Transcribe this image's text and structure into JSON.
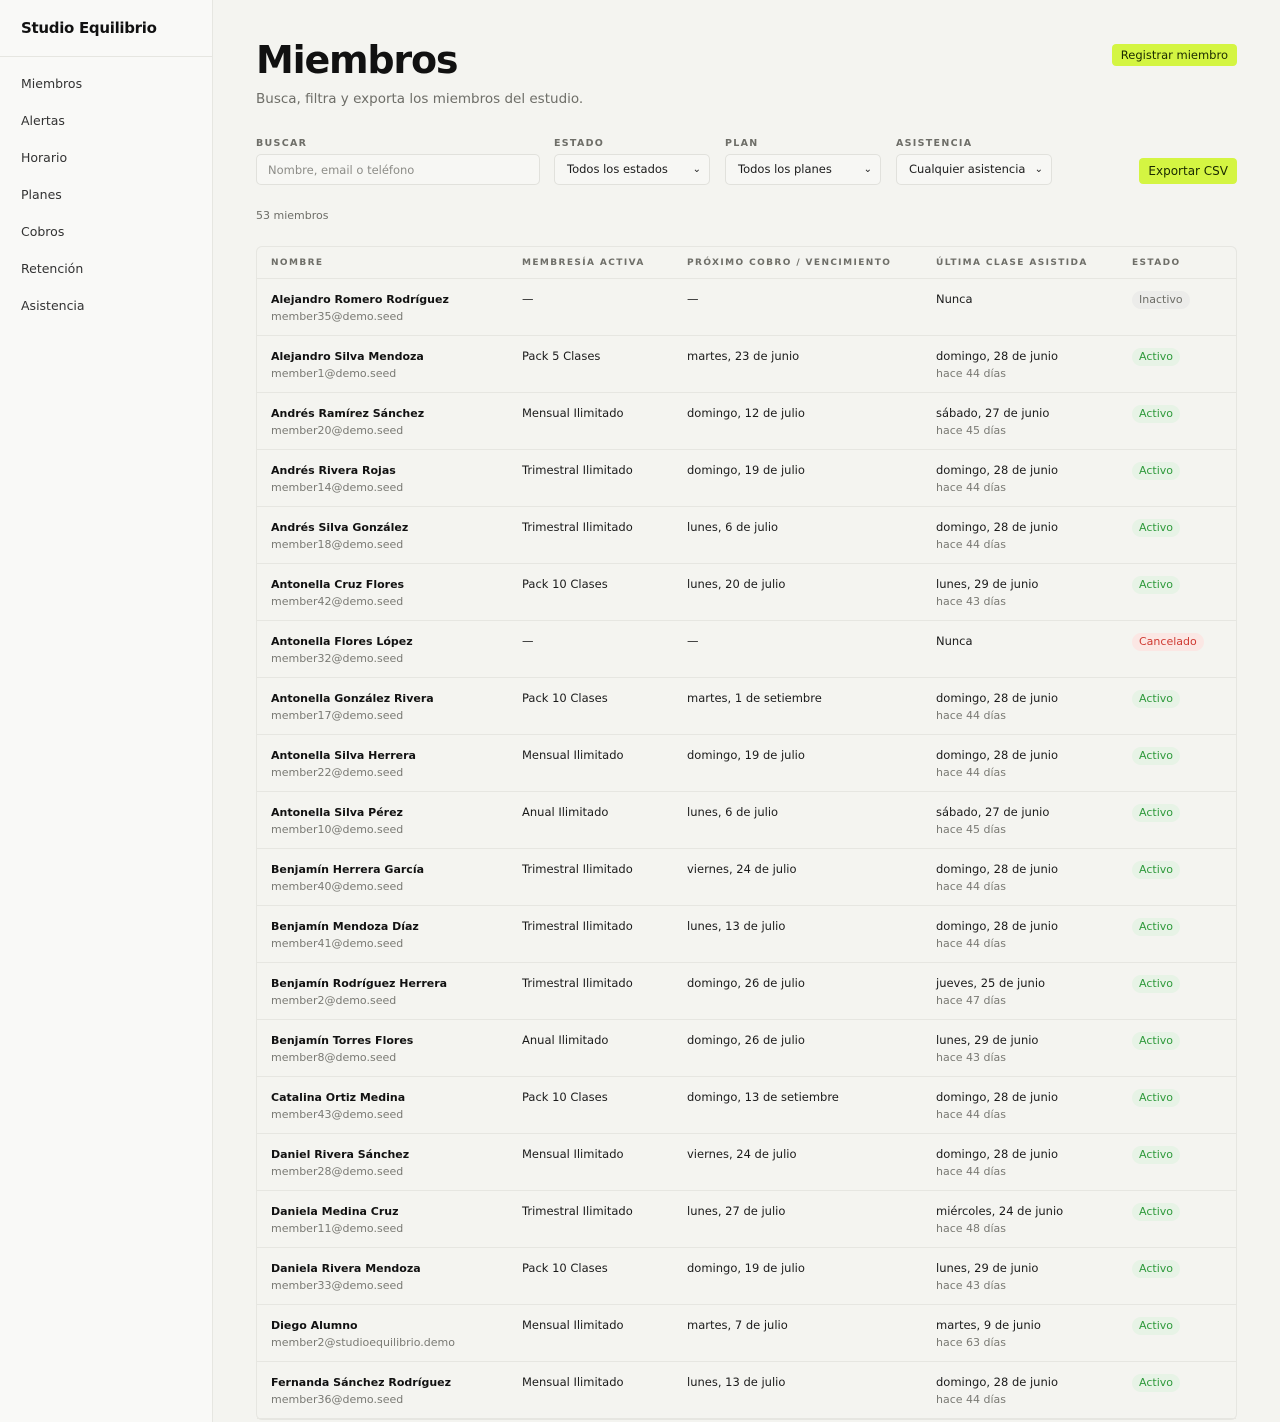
{
  "app": {
    "name": "Studio Equilibrio"
  },
  "sidebar": {
    "items": [
      {
        "label": "Miembros"
      },
      {
        "label": "Alertas"
      },
      {
        "label": "Horario"
      },
      {
        "label": "Planes"
      },
      {
        "label": "Cobros"
      },
      {
        "label": "Retención"
      },
      {
        "label": "Asistencia"
      }
    ]
  },
  "header": {
    "title": "Miembros",
    "subtitle": "Busca, filtra y exporta los miembros del estudio.",
    "register_label": "Registrar miembro"
  },
  "filters": {
    "search_label": "BUSCAR",
    "search_placeholder": "Nombre, email o teléfono",
    "status_label": "ESTADO",
    "status_value": "Todos los estados",
    "plan_label": "PLAN",
    "plan_value": "Todos los planes",
    "attendance_label": "ASISTENCIA",
    "attendance_value": "Cualquier asistencia",
    "export_label": "Exportar CSV"
  },
  "count_text": "53 miembros",
  "table": {
    "headers": {
      "name": "NOMBRE",
      "plan": "MEMBRESÍA ACTIVA",
      "next": "PRÓXIMO COBRO / VENCIMIENTO",
      "last": "ÚLTIMA CLASE ASISTIDA",
      "status": "ESTADO"
    },
    "rows": [
      {
        "name": "Alejandro Romero Rodríguez",
        "email": "member35@demo.seed",
        "plan": "—",
        "next": "—",
        "last": "Nunca",
        "last_ago": "",
        "status": "Inactivo",
        "kind": "inactive"
      },
      {
        "name": "Alejandro Silva Mendoza",
        "email": "member1@demo.seed",
        "plan": "Pack 5 Clases",
        "next": "martes, 23 de junio",
        "last": "domingo, 28 de junio",
        "last_ago": "hace 44 días",
        "status": "Activo",
        "kind": "active"
      },
      {
        "name": "Andrés Ramírez Sánchez",
        "email": "member20@demo.seed",
        "plan": "Mensual Ilimitado",
        "next": "domingo, 12 de julio",
        "last": "sábado, 27 de junio",
        "last_ago": "hace 45 días",
        "status": "Activo",
        "kind": "active"
      },
      {
        "name": "Andrés Rivera Rojas",
        "email": "member14@demo.seed",
        "plan": "Trimestral Ilimitado",
        "next": "domingo, 19 de julio",
        "last": "domingo, 28 de junio",
        "last_ago": "hace 44 días",
        "status": "Activo",
        "kind": "active"
      },
      {
        "name": "Andrés Silva González",
        "email": "member18@demo.seed",
        "plan": "Trimestral Ilimitado",
        "next": "lunes, 6 de julio",
        "last": "domingo, 28 de junio",
        "last_ago": "hace 44 días",
        "status": "Activo",
        "kind": "active"
      },
      {
        "name": "Antonella Cruz Flores",
        "email": "member42@demo.seed",
        "plan": "Pack 10 Clases",
        "next": "lunes, 20 de julio",
        "last": "lunes, 29 de junio",
        "last_ago": "hace 43 días",
        "status": "Activo",
        "kind": "active"
      },
      {
        "name": "Antonella Flores López",
        "email": "member32@demo.seed",
        "plan": "—",
        "next": "—",
        "last": "Nunca",
        "last_ago": "",
        "status": "Cancelado",
        "kind": "cancel"
      },
      {
        "name": "Antonella González Rivera",
        "email": "member17@demo.seed",
        "plan": "Pack 10 Clases",
        "next": "martes, 1 de setiembre",
        "last": "domingo, 28 de junio",
        "last_ago": "hace 44 días",
        "status": "Activo",
        "kind": "active"
      },
      {
        "name": "Antonella Silva Herrera",
        "email": "member22@demo.seed",
        "plan": "Mensual Ilimitado",
        "next": "domingo, 19 de julio",
        "last": "domingo, 28 de junio",
        "last_ago": "hace 44 días",
        "status": "Activo",
        "kind": "active"
      },
      {
        "name": "Antonella Silva Pérez",
        "email": "member10@demo.seed",
        "plan": "Anual Ilimitado",
        "next": "lunes, 6 de julio",
        "last": "sábado, 27 de junio",
        "last_ago": "hace 45 días",
        "status": "Activo",
        "kind": "active"
      },
      {
        "name": "Benjamín Herrera García",
        "email": "member40@demo.seed",
        "plan": "Trimestral Ilimitado",
        "next": "viernes, 24 de julio",
        "last": "domingo, 28 de junio",
        "last_ago": "hace 44 días",
        "status": "Activo",
        "kind": "active"
      },
      {
        "name": "Benjamín Mendoza Díaz",
        "email": "member41@demo.seed",
        "plan": "Trimestral Ilimitado",
        "next": "lunes, 13 de julio",
        "last": "domingo, 28 de junio",
        "last_ago": "hace 44 días",
        "status": "Activo",
        "kind": "active"
      },
      {
        "name": "Benjamín Rodríguez Herrera",
        "email": "member2@demo.seed",
        "plan": "Trimestral Ilimitado",
        "next": "domingo, 26 de julio",
        "last": "jueves, 25 de junio",
        "last_ago": "hace 47 días",
        "status": "Activo",
        "kind": "active"
      },
      {
        "name": "Benjamín Torres Flores",
        "email": "member8@demo.seed",
        "plan": "Anual Ilimitado",
        "next": "domingo, 26 de julio",
        "last": "lunes, 29 de junio",
        "last_ago": "hace 43 días",
        "status": "Activo",
        "kind": "active"
      },
      {
        "name": "Catalina Ortiz Medina",
        "email": "member43@demo.seed",
        "plan": "Pack 10 Clases",
        "next": "domingo, 13 de setiembre",
        "last": "domingo, 28 de junio",
        "last_ago": "hace 44 días",
        "status": "Activo",
        "kind": "active"
      },
      {
        "name": "Daniel Rivera Sánchez",
        "email": "member28@demo.seed",
        "plan": "Mensual Ilimitado",
        "next": "viernes, 24 de julio",
        "last": "domingo, 28 de junio",
        "last_ago": "hace 44 días",
        "status": "Activo",
        "kind": "active"
      },
      {
        "name": "Daniela Medina Cruz",
        "email": "member11@demo.seed",
        "plan": "Trimestral Ilimitado",
        "next": "lunes, 27 de julio",
        "last": "miércoles, 24 de junio",
        "last_ago": "hace 48 días",
        "status": "Activo",
        "kind": "active"
      },
      {
        "name": "Daniela Rivera Mendoza",
        "email": "member33@demo.seed",
        "plan": "Pack 10 Clases",
        "next": "domingo, 19 de julio",
        "last": "lunes, 29 de junio",
        "last_ago": "hace 43 días",
        "status": "Activo",
        "kind": "active"
      },
      {
        "name": "Diego Alumno",
        "email": "member2@studioequilibrio.demo",
        "plan": "Mensual Ilimitado",
        "next": "martes, 7 de julio",
        "last": "martes, 9 de junio",
        "last_ago": "hace 63 días",
        "status": "Activo",
        "kind": "active"
      },
      {
        "name": "Fernanda Sánchez Rodríguez",
        "email": "member36@demo.seed",
        "plan": "Mensual Ilimitado",
        "next": "lunes, 13 de julio",
        "last": "domingo, 28 de junio",
        "last_ago": "hace 44 días",
        "status": "Activo",
        "kind": "active"
      }
    ]
  }
}
